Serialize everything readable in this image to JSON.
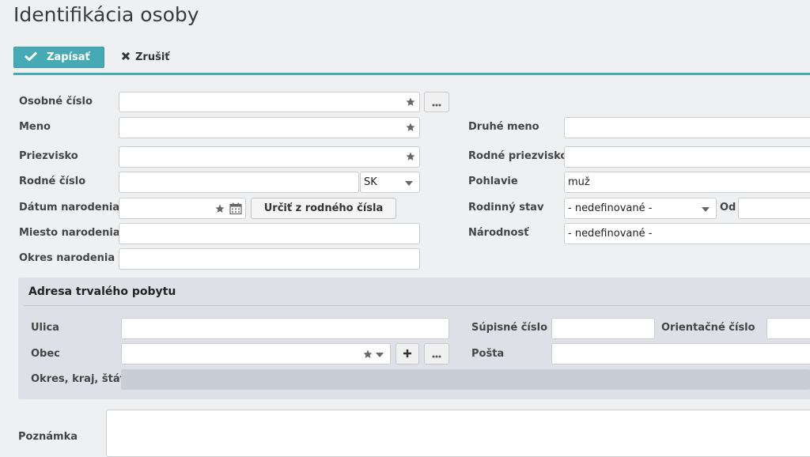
{
  "page": {
    "title": "Identifikácia osoby"
  },
  "toolbar": {
    "save_label": "Zapísať",
    "cancel_label": "Zrušiť"
  },
  "person": {
    "osobne_cislo_label": "Osobné číslo",
    "meno_label": "Meno",
    "priezvisko_label": "Priezvisko",
    "rodne_cislo_label": "Rodné číslo",
    "rodne_cislo_country": "SK",
    "datum_narodenia_label": "Dátum narodenia",
    "urcit_button_label": "Určiť z rodného čísla",
    "miesto_narodenia_label": "Miesto narodenia",
    "okres_narodenia_label": "Okres narodenia",
    "druhe_meno_label": "Druhé meno",
    "rodne_priezvisko_label": "Rodné priezvisko",
    "pohlavie_label": "Pohlavie",
    "pohlavie_value": "muž",
    "rodinny_stav_label": "Rodinný stav",
    "rodinny_stav_value": "- nedefinované -",
    "od_label": "Od",
    "narodnost_label": "Národnosť",
    "narodnost_value": "- nedefinované -"
  },
  "address": {
    "title": "Adresa trvalého pobytu",
    "ulica_label": "Ulica",
    "obec_label": "Obec",
    "okres_kraj_stat_label": "Okres, kraj, štát",
    "supisne_cislo_label": "Súpisné číslo",
    "orientacne_cislo_label": "Orientačné číslo",
    "posta_label": "Pošta"
  },
  "note": {
    "label": "Poznámka"
  },
  "icons": {
    "save": "check-icon",
    "cancel": "x-icon",
    "required": "star-icon",
    "more": "ellipsis-icon",
    "calendar": "calendar-icon",
    "add": "plus-icon",
    "dropdown": "chevron-down-icon"
  },
  "colors": {
    "accent": "#46aab5",
    "panel": "#dde1e7",
    "disabled": "#c9ced6"
  }
}
